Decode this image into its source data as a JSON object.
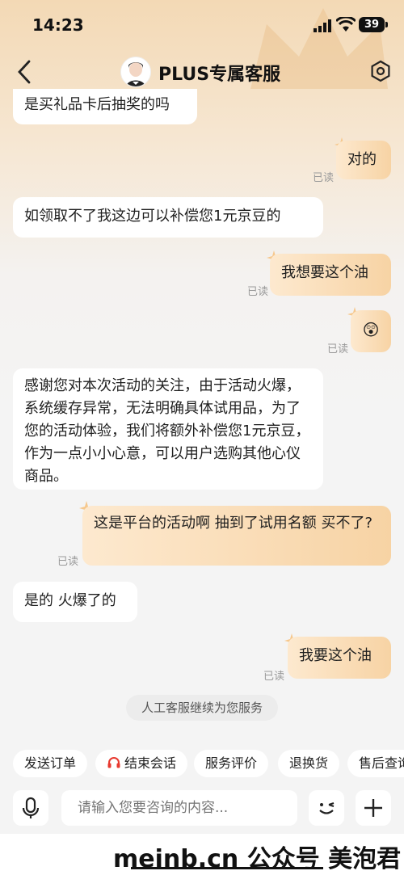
{
  "status": {
    "time": "14:23",
    "battery": "39"
  },
  "header": {
    "title": "PLUS专属客服"
  },
  "messages": [
    {
      "side": "left",
      "text": "是买礼品卡后抽奖的吗"
    },
    {
      "side": "right",
      "text": "对的",
      "read": "已读"
    },
    {
      "side": "left",
      "text": "如领取不了我这边可以补偿您1元京豆的"
    },
    {
      "side": "right",
      "text": "我想要这个油",
      "read": "已读"
    },
    {
      "side": "right",
      "text": "😲",
      "read": "已读"
    },
    {
      "side": "left",
      "text": "感谢您对本次活动的关注，由于活动火爆，系统缓存异常，无法明确具体试用品，为了您的活动体验，我们将额外补偿您1元京豆，作为一点小小心意，可以用户选购其他心仪商品。"
    },
    {
      "side": "right",
      "text": "这是平台的活动啊 抽到了试用名额 买不了?",
      "read": "已读"
    },
    {
      "side": "left",
      "text": "是的 火爆了的"
    },
    {
      "side": "right",
      "text": "我要这个油",
      "read": "已读"
    }
  ],
  "system_note": "人工客服继续为您服务",
  "quick_actions": [
    "发送订单",
    "结束会话",
    "服务评价",
    "退换货",
    "售后查询"
  ],
  "input": {
    "placeholder": "请输入您要咨询的内容..."
  },
  "watermark": "meinb.cn  公众号 美泡君",
  "colors": {
    "accent": "#f7d3a4",
    "bubble_left": "#ffffff",
    "headset": "#e8392f"
  }
}
